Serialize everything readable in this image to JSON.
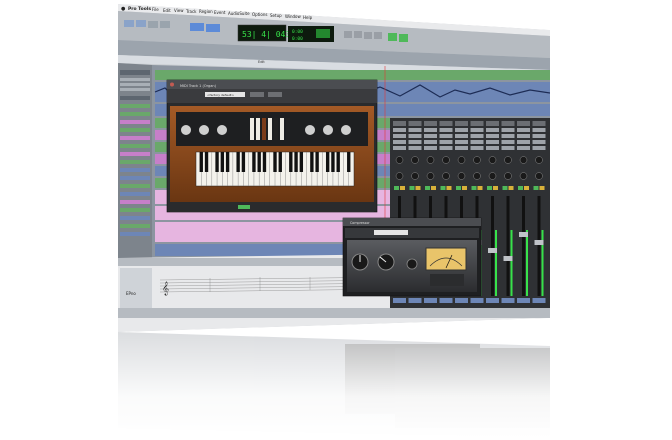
{
  "menubar": {
    "app_name": "Pro Tools",
    "items": [
      "File",
      "Edit",
      "View",
      "Track",
      "Region",
      "Event",
      "AudioSuite",
      "Options",
      "Setup",
      "Window",
      "Help"
    ]
  },
  "transport": {
    "main_counter": "53| 4| 043",
    "sub_counter_a": "0:00",
    "sub_counter_b": "0:00"
  },
  "edit_window": {
    "mini_timeline_label": "Edit"
  },
  "plugin_organ": {
    "title": "MIDI Track 1 (Organ)",
    "preset_label": "<factory default>",
    "brand_letter": "b"
  },
  "plugin_compressor": {
    "title": "Compressor"
  },
  "score_editor": {
    "track_name": "EPno"
  },
  "colors": {
    "window_bg": "#c8ccd0",
    "track_blue": "#6d86b6",
    "track_green": "#6da46a",
    "track_pink": "#c67fc9",
    "organ_wood": "#8a4a1e",
    "counter_green": "#37e24a",
    "plugin_panel": "#2a2b2d"
  },
  "icons": [
    "apple-icon",
    "play-icon",
    "stop-icon",
    "record-icon",
    "knob-icon",
    "vu-meter-icon"
  ]
}
